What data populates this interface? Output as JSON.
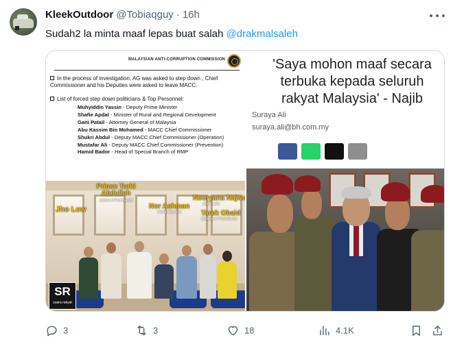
{
  "tweet": {
    "display_name": "KleekOutdoor",
    "handle": "@Tobiaqguy",
    "separator": "·",
    "time": "16h",
    "text_before": "Sudah2 la minta maaf lepas buat salah ",
    "mention": "@drakmalsaleh",
    "avatar_icon": "avatar-car-photo",
    "more_icon": "more-horizontal-icon"
  },
  "media": {
    "document": {
      "title": "MALAYSIAN ANTI-CORRUPTION COMMISSION",
      "bullet1": "In the process of investigation, AG was asked to step down , Chief Commissioner and his Deputies were asked to leave MACC.",
      "bullet2": "List of forced step down politicians & Top Personnel:",
      "people": [
        {
          "name": "Muhyiddin Yassin",
          "role": " - Deputy Prime Minister"
        },
        {
          "name": "Shafie Apdal",
          "role": " - Minister of Rural and Regional Development"
        },
        {
          "name": "Gani Patail",
          "role": " - Attorney General of Malaysia"
        },
        {
          "name": "Abu Kassim Bin Mohamed",
          "role": " - MACC Chief Commissioner"
        },
        {
          "name": "Shukri Abdul",
          "role": " - Deputy MACC Chief Commissioner (Operation)"
        },
        {
          "name": "Mustafar Ali",
          "role": " - Deputy MACC Chief Commissioner (Prevention)"
        },
        {
          "name": "Hamid Bador",
          "role": " - Head of Special Branch of RMP"
        }
      ]
    },
    "group_photo": {
      "labels": {
        "prince": "Prince Turki Abdullah",
        "prince_sub": "(owner of PetroSaudi)",
        "jho": "Jho Low",
        "nor": "Nor Ashman",
        "nor_sub": "(Jho's step son)",
        "nooryana": "Nooryana Najwa",
        "nooryana_sub": "(Jho's wife)",
        "tarek": "Tarek Obaid",
        "tarek_sub": "(Director of PetroSaudi)"
      },
      "logo_text": "SR",
      "logo_sub": "suara rakyat"
    },
    "article": {
      "headline": "'Saya mohon maaf secara terbuka kepada seluruh rakyat Malaysia' - Najib",
      "author": "Suraya Ali",
      "email": "suraya.ali@bh.com.my",
      "share_colors": [
        "#3b5998",
        "#25d366",
        "#111111",
        "#8e8e8e"
      ]
    }
  },
  "actions": {
    "replies": "3",
    "retweets": "3",
    "likes": "18",
    "views": "4.1K"
  }
}
